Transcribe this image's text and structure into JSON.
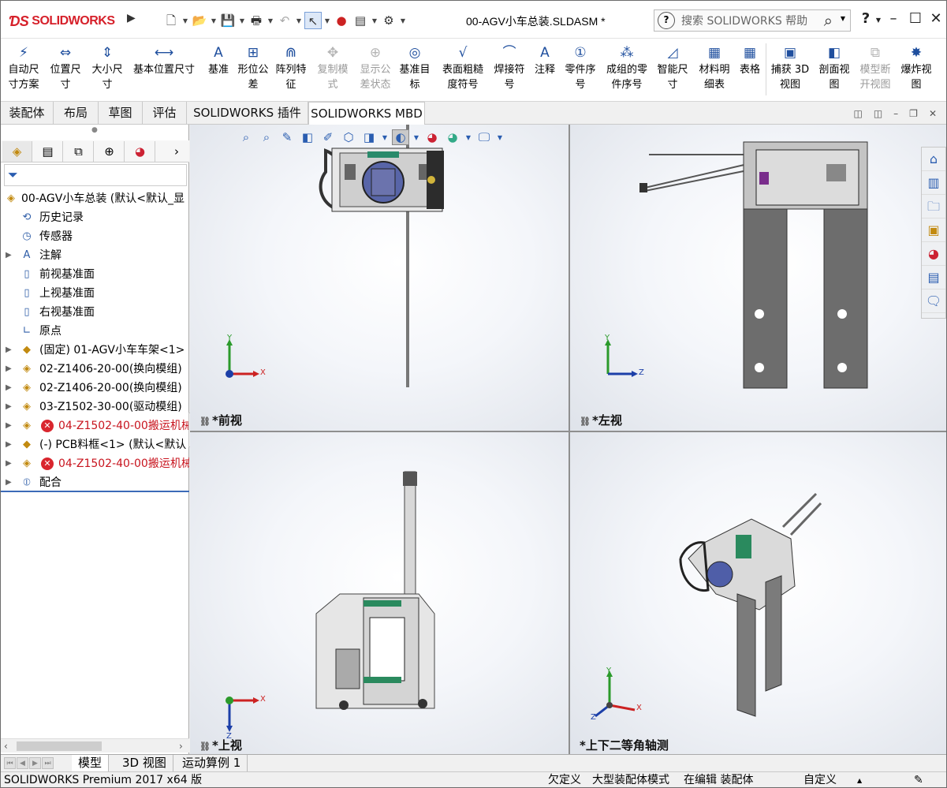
{
  "app": {
    "logo_text": "SOLIDWORKS",
    "document_title": "00-AGV小车总装.SLDASM *",
    "search_placeholder": "搜索 SOLIDWORKS 帮助",
    "help_label": "?"
  },
  "command_manager": {
    "items": [
      {
        "line1": "自动尺",
        "line2": "寸方案",
        "icon": "auto-dimension-icon",
        "enabled": true
      },
      {
        "line1": "位置尺",
        "line2": "寸",
        "icon": "location-dimension-icon",
        "enabled": true
      },
      {
        "line1": "大小尺",
        "line2": "寸",
        "icon": "size-dimension-icon",
        "enabled": true
      },
      {
        "line1": "基本位置尺寸",
        "line2": "",
        "icon": "basic-location-dimension-icon",
        "enabled": true
      },
      {
        "line1": "基准",
        "line2": "",
        "icon": "datum-icon",
        "enabled": true
      },
      {
        "line1": "形位公",
        "line2": "差",
        "icon": "geometric-tolerance-icon",
        "enabled": true
      },
      {
        "line1": "阵列特",
        "line2": "征",
        "icon": "pattern-feature-icon",
        "enabled": true
      },
      {
        "line1": "复制模",
        "line2": "式",
        "icon": "copy-scheme-icon",
        "enabled": false
      },
      {
        "line1": "显示公",
        "line2": "差状态",
        "icon": "show-tolerance-status-icon",
        "enabled": false
      },
      {
        "line1": "基准目",
        "line2": "标",
        "icon": "datum-target-icon",
        "enabled": true
      },
      {
        "line1": "表面粗糙",
        "line2": "度符号",
        "icon": "surface-finish-icon",
        "enabled": true
      },
      {
        "line1": "焊接符",
        "line2": "号",
        "icon": "weld-symbol-icon",
        "enabled": true
      },
      {
        "line1": "注释",
        "line2": "",
        "icon": "note-icon",
        "enabled": true
      },
      {
        "line1": "零件序",
        "line2": "号",
        "icon": "balloon-icon",
        "enabled": true
      },
      {
        "line1": "成组的零",
        "line2": "件序号",
        "icon": "stacked-balloon-icon",
        "enabled": true
      },
      {
        "line1": "智能尺",
        "line2": "寸",
        "icon": "smart-dimension-icon",
        "enabled": true
      },
      {
        "line1": "材料明",
        "line2": "细表",
        "icon": "bill-of-materials-icon",
        "enabled": true
      },
      {
        "line1": "表格",
        "line2": "",
        "icon": "table-icon",
        "enabled": true
      },
      {
        "line1": "捕获 3D",
        "line2": "视图",
        "icon": "capture-3d-view-icon",
        "enabled": true
      },
      {
        "line1": "剖面视",
        "line2": "图",
        "icon": "section-view-icon",
        "enabled": true
      },
      {
        "line1": "模型断",
        "line2": "开视图",
        "icon": "model-break-view-icon",
        "enabled": false
      },
      {
        "line1": "爆炸视",
        "line2": "图",
        "icon": "explode-view-icon",
        "enabled": true
      }
    ]
  },
  "tabs": [
    "装配体",
    "布局",
    "草图",
    "评估",
    "SOLIDWORKS 插件",
    "SOLIDWORKS MBD"
  ],
  "active_tab": "SOLIDWORKS MBD",
  "tree": {
    "root": "00-AGV小车总装 (默认<默认_显",
    "items": [
      {
        "label": "历史记录",
        "icon": "history-icon",
        "expandable": false,
        "error": false
      },
      {
        "label": "传感器",
        "icon": "sensor-icon",
        "expandable": false,
        "error": false
      },
      {
        "label": "注解",
        "icon": "annotation-icon",
        "expandable": true,
        "error": false
      },
      {
        "label": "前视基准面",
        "icon": "plane-icon",
        "expandable": false,
        "error": false
      },
      {
        "label": "上视基准面",
        "icon": "plane-icon",
        "expandable": false,
        "error": false
      },
      {
        "label": "右视基准面",
        "icon": "plane-icon",
        "expandable": false,
        "error": false
      },
      {
        "label": "原点",
        "icon": "origin-icon",
        "expandable": false,
        "error": false
      },
      {
        "label": "(固定) 01-AGV小车车架<1>",
        "icon": "part-icon",
        "expandable": true,
        "error": false
      },
      {
        "label": "02-Z1406-20-00(换向模组)",
        "icon": "subassembly-icon",
        "expandable": true,
        "error": false
      },
      {
        "label": "02-Z1406-20-00(换向模组)",
        "icon": "subassembly-icon",
        "expandable": true,
        "error": false
      },
      {
        "label": "03-Z1502-30-00(驱动模组)",
        "icon": "subassembly-icon",
        "expandable": true,
        "error": false
      },
      {
        "label": "04-Z1502-40-00搬运机械",
        "icon": "subassembly-icon",
        "expandable": true,
        "error": true
      },
      {
        "label": "(-) PCB料框<1> (默认<默认",
        "icon": "part-icon",
        "expandable": true,
        "error": false
      },
      {
        "label": "04-Z1502-40-00搬运机械",
        "icon": "subassembly-icon",
        "expandable": true,
        "error": true
      },
      {
        "label": "配合",
        "icon": "mates-icon",
        "expandable": true,
        "error": false
      }
    ]
  },
  "viewports": [
    {
      "label": "*前视",
      "axes": [
        "Y",
        "X"
      ]
    },
    {
      "label": "*左视",
      "axes": [
        "Y",
        "Z"
      ]
    },
    {
      "label": "*上视",
      "axes": [
        "X",
        "Z"
      ]
    },
    {
      "label": "*上下二等角轴测",
      "axes": [
        "Y",
        "X",
        "Z"
      ]
    }
  ],
  "bottom_tabs": [
    "模型",
    "3D 视图",
    "运动算例 1"
  ],
  "active_bottom_tab": "模型",
  "status": {
    "product": "SOLIDWORKS Premium 2017 x64 版",
    "definition": "欠定义",
    "mode": "大型装配体模式",
    "editing": "在编辑 装配体",
    "units": "自定义"
  }
}
